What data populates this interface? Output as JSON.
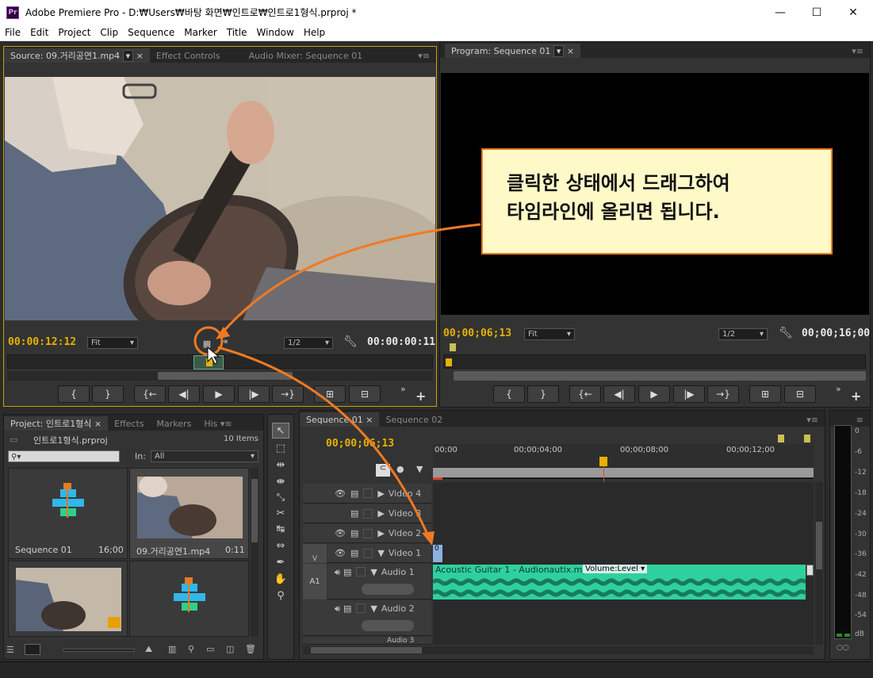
{
  "window": {
    "app_icon": "Pr",
    "title": "Adobe Premiere Pro - D:₩Users₩바탕 화면₩인트로₩인트로1형식.prproj *",
    "minimize": "—",
    "maximize": "☐",
    "close": "✕"
  },
  "menu": [
    "File",
    "Edit",
    "Project",
    "Clip",
    "Sequence",
    "Marker",
    "Title",
    "Window",
    "Help"
  ],
  "source_panel": {
    "tabs": [
      "Source: 09.거리공연1.mp4",
      "Effect Controls",
      "Audio Mixer: Sequence 01"
    ],
    "timecode_left": "00:00:12:12",
    "zoom": "Fit",
    "resolution": "1/2",
    "timecode_right": "00:00:00:11"
  },
  "program_panel": {
    "tab": "Program: Sequence 01",
    "timecode_left": "00;00;06;13",
    "zoom": "Fit",
    "resolution": "1/2",
    "timecode_right": "00;00;16;00"
  },
  "transport_glyphs": {
    "mark_in": "{",
    "mark_out": "}",
    "goto_in": "{←",
    "step_back": "◀|",
    "play": "▶",
    "step_fwd": "|▶",
    "goto_out": "→}",
    "insert": "⊞",
    "overwrite": "⊟",
    "more": "»",
    "add": "+"
  },
  "callout": {
    "line1": "클릭한 상태에서 드래그하여",
    "line2": "타임라인에 올리면 됩니다."
  },
  "project_panel": {
    "tabs": [
      "Project: 인트로1형식",
      "Effects",
      "Markers",
      "His"
    ],
    "project_file": "인트로1형식.prproj",
    "item_count": "10 Items",
    "in_label": "In:",
    "in_value": "All",
    "items": [
      {
        "name": "Sequence 01",
        "duration": "16;00"
      },
      {
        "name": "09.거리공연1.mp4",
        "duration": "0:11"
      },
      {
        "name": "",
        "duration": ""
      },
      {
        "name": "",
        "duration": ""
      }
    ]
  },
  "timeline": {
    "tabs": [
      "Sequence 01",
      "Sequence 02"
    ],
    "timecode": "00;00;06;13",
    "ruler": [
      "00;00",
      "00;00;04;00",
      "00;00;08;00",
      "00;00;12;00"
    ],
    "tracks": [
      {
        "name": "Video 4",
        "type": "video"
      },
      {
        "name": "Video 3",
        "type": "video"
      },
      {
        "name": "Video 2",
        "type": "video"
      },
      {
        "name": "Video 1",
        "type": "video"
      },
      {
        "name": "Audio 1",
        "type": "audio"
      },
      {
        "name": "Audio 2",
        "type": "audio"
      },
      {
        "name": "Audio 3",
        "type": "audio"
      }
    ],
    "source_v": "V",
    "source_a": "A1",
    "audio_clip": "Acoustic Guitar 1 - Audionautix.mp3",
    "volume": "Volume:Level",
    "clip_v1": "0"
  },
  "meter": {
    "labels": [
      "0",
      "-6",
      "-12",
      "-18",
      "-24",
      "-30",
      "-36",
      "-42",
      "-48",
      "-54",
      "dB"
    ]
  },
  "colors": {
    "accent_timecode": "#e8b100",
    "callout_border": "#e87a22",
    "callout_fill": "#fff9c8",
    "audio_clip": "#2fd0a0",
    "playhead": "#e0452a"
  }
}
